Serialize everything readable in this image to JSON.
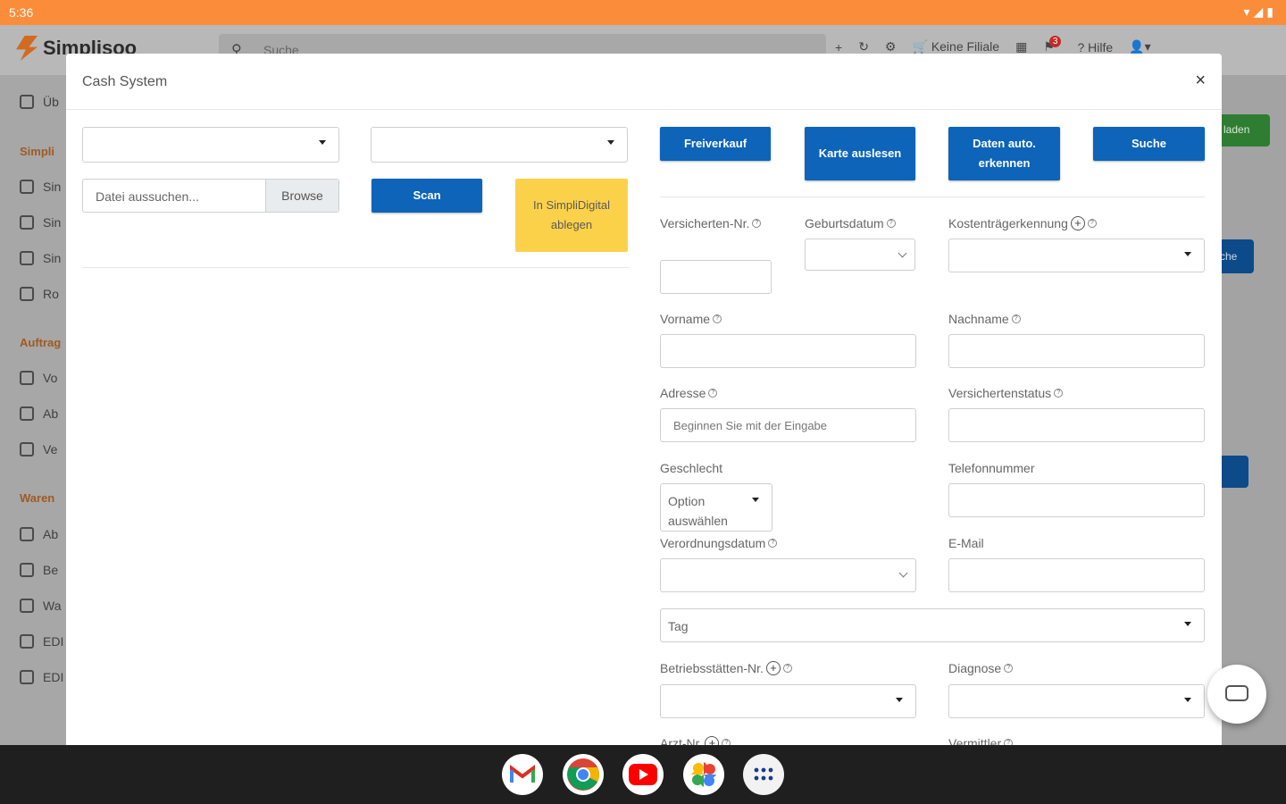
{
  "status_bar": {
    "time": "5:36"
  },
  "app": {
    "name": "Simplisoo",
    "search_placeholder": "Suche",
    "tools": {
      "branch_label": "Keine Filiale",
      "help_label": "Hilfe",
      "notification_count": "3"
    },
    "sidebar": {
      "overview": "Üb",
      "sections": [
        "Simpli",
        "Auftrag",
        "Waren"
      ],
      "items": [
        "Sin",
        "Sin",
        "Sin",
        "Ro",
        "Vo",
        "Ab",
        "Ve",
        "Ab",
        "Be",
        "Wa",
        "EDI",
        "EDI"
      ]
    },
    "right_buttons": {
      "green": "laden",
      "blue": "che"
    }
  },
  "modal": {
    "title": "Cash System",
    "close_label": "×",
    "file_input": {
      "placeholder": "Datei aussuchen...",
      "browse_label": "Browse"
    },
    "scan_label": "Scan",
    "store_label": "In SimpliDigital ablegen",
    "buttons": {
      "freiverkauf": "Freiverkauf",
      "karte_auslesen": "Karte auslesen",
      "daten_auto": "Daten auto. erkennen",
      "suche": "Suche"
    },
    "fields": {
      "versicherten_nr": "Versicherten-Nr.",
      "geburtsdatum": "Geburtsdatum",
      "kostentraeger": "Kostenträgerkennung",
      "vorname": "Vorname",
      "nachname": "Nachname",
      "adresse": "Adresse",
      "adresse_placeholder": "Beginnen Sie mit der Eingabe",
      "versichertenstatus": "Versichertenstatus",
      "geschlecht": "Geschlecht",
      "geschlecht_value": "Option auswählen",
      "telefonnummer": "Telefonnummer",
      "verordnungsdatum": "Verordnungsdatum",
      "email": "E-Mail",
      "tag_placeholder": "Tag",
      "betriebsstaetten": "Betriebsstätten-Nr.",
      "diagnose": "Diagnose",
      "arzt_nr": "Arzt-Nr.",
      "vermittler": "Vermittler"
    }
  },
  "taskbar": {
    "apps": [
      "gmail-icon",
      "chrome-icon",
      "youtube-icon",
      "photos-icon",
      "app-launcher-icon"
    ]
  }
}
